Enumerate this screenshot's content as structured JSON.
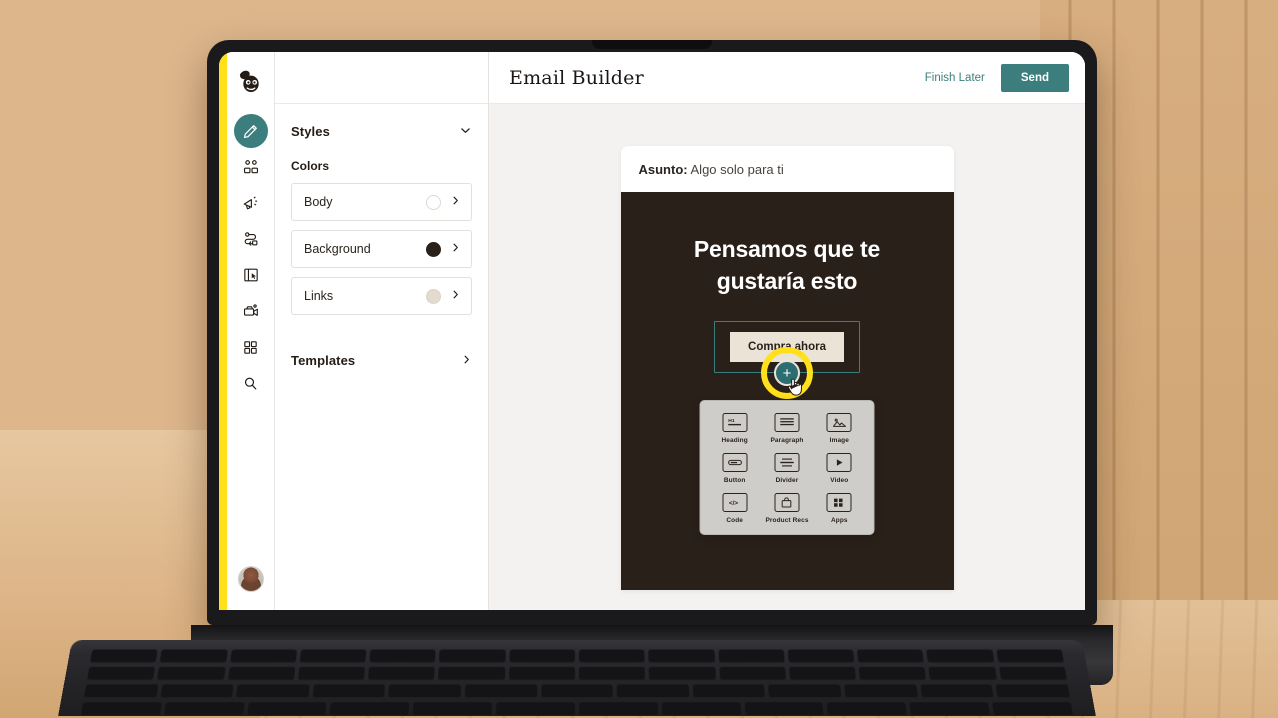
{
  "app": {
    "brand_logo": "mailchimp-freddie-logo",
    "accent_color": "#3c7d7d",
    "brand_yellow": "#ffe01b",
    "title": "Email Builder"
  },
  "topbar": {
    "title": "Email Builder",
    "finish_later_label": "Finish Later",
    "send_label": "Send"
  },
  "rail": {
    "items": [
      {
        "icon": "pencil-icon",
        "name": "campaigns",
        "active": true
      },
      {
        "icon": "audience-people-icon",
        "name": "audience",
        "active": false
      },
      {
        "icon": "megaphone-icon",
        "name": "marketing",
        "active": false
      },
      {
        "icon": "journey-automation-icon",
        "name": "automations",
        "active": false
      },
      {
        "icon": "landing-page-icon",
        "name": "website",
        "active": false
      },
      {
        "icon": "content-studio-icon",
        "name": "content",
        "active": false
      },
      {
        "icon": "apps-grid-icon",
        "name": "integrations",
        "active": false
      },
      {
        "icon": "search-icon",
        "name": "search",
        "active": false
      }
    ],
    "avatar": "user-avatar"
  },
  "panel": {
    "styles_section": "Styles",
    "colors_group": "Colors",
    "colors": [
      {
        "label": "Body",
        "swatch": "#ffffff"
      },
      {
        "label": "Background",
        "swatch": "#2a201a"
      },
      {
        "label": "Links",
        "swatch": "#e4dbd0"
      }
    ],
    "templates_section": "Templates",
    "chevron_down": "⌄",
    "chevron_right": "›"
  },
  "email": {
    "subject_label": "Asunto:",
    "subject_value": "Algo solo para ti",
    "heading": "Pensamos que te gustaría esto",
    "cta_label": "Compra ahora",
    "body_bg": "#2a201a",
    "add_button_glyph": "+"
  },
  "block_picker": {
    "blocks": [
      {
        "label": "Heading",
        "icon": "heading-h1-icon"
      },
      {
        "label": "Paragraph",
        "icon": "paragraph-lines-icon"
      },
      {
        "label": "Image",
        "icon": "image-mountain-icon"
      },
      {
        "label": "Button",
        "icon": "button-pill-icon"
      },
      {
        "label": "Divider",
        "icon": "divider-lines-icon"
      },
      {
        "label": "Video",
        "icon": "video-play-icon"
      },
      {
        "label": "Code",
        "icon": "code-brackets-icon"
      },
      {
        "label": "Product Recs",
        "icon": "shopping-bag-icon"
      },
      {
        "label": "Apps",
        "icon": "apps-squares-icon"
      }
    ]
  }
}
